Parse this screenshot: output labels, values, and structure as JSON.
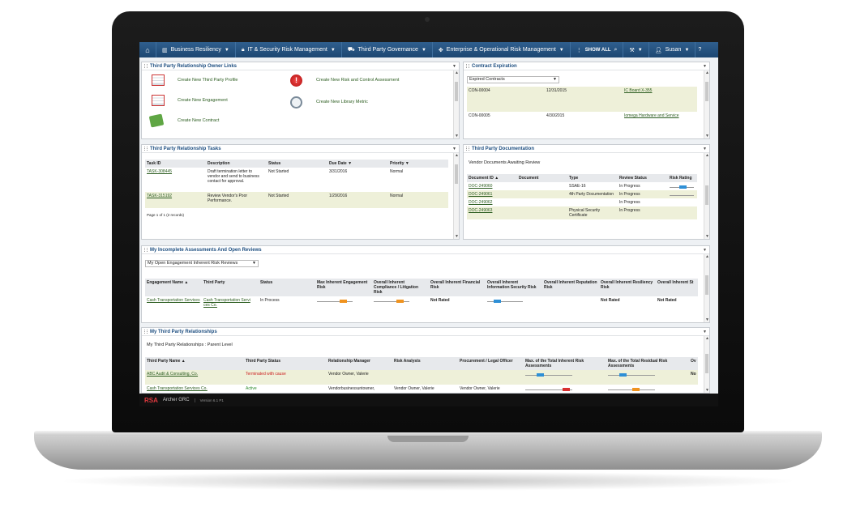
{
  "nav": {
    "items": [
      {
        "label": "Business Resiliency"
      },
      {
        "label": "IT & Security Risk Management"
      },
      {
        "label": "Third Party Governance"
      },
      {
        "label": "Enterprise & Operational Risk Management"
      }
    ],
    "show_all": "SHOW ALL",
    "user": "Susan"
  },
  "owner_links": {
    "title": "Third Party Relationship Owner Links",
    "left": [
      "Create New Third Party Profile",
      "Create New Engagement",
      "Create New Contract"
    ],
    "right": [
      "Create New Risk and Control Assessment",
      "Create New Library Metric"
    ]
  },
  "contract": {
    "title": "Contract Expiration",
    "filter": "Expired Contracts",
    "rows": [
      {
        "id": "CON-00004",
        "date": "12/31/2015",
        "name": "IC Board X-355"
      },
      {
        "id": "CON-00005",
        "date": "4/30/2015",
        "name": "Iomega Hardware and Service"
      }
    ]
  },
  "tasks": {
    "title": "Third Party Relationship Tasks",
    "headers": [
      "Task ID",
      "Description",
      "Status",
      "Due Date",
      "Priority"
    ],
    "rows": [
      {
        "id": "TASK-308445",
        "desc": "Draft termination letter to vendor and send to business contact for approval.",
        "status": "Not Started",
        "due": "3/31/2016",
        "priority": "Normal"
      },
      {
        "id": "TASK-315192",
        "desc": "Review Vendor's Poor Performance.",
        "status": "Not Started",
        "due": "1/29/2016",
        "priority": "Normal"
      }
    ],
    "pager": "Page 1 of 1 (2 records)"
  },
  "docs": {
    "title": "Third Party Documentation",
    "subtitle": "Vendor Documents Awaiting Review",
    "headers": [
      "Document ID",
      "Document",
      "Type",
      "Review Status",
      "Risk Rating"
    ],
    "rows": [
      {
        "id": "DOC-249060",
        "type": "SSAE-16",
        "status": "In Progress"
      },
      {
        "id": "DOC-249061",
        "type": "4th Party Documentation",
        "status": "In Progress"
      },
      {
        "id": "DOC-249062",
        "type": "",
        "status": "In Progress"
      },
      {
        "id": "DOC-249063",
        "type": "Physical Security Certificate",
        "status": "In Progress"
      }
    ]
  },
  "assess": {
    "title": "My Incomplete Assessments And Open Reviews",
    "filter": "My Open Engagement Inherent Risk Reviews",
    "headers": [
      "Engagement Name",
      "Third Party",
      "Status",
      "Max Inherent Engagement Risk",
      "Overall Inherent Compliance / Litigation Risk",
      "Overall Inherent Financial Risk",
      "Overall Inherent Information Security Risk",
      "Overall Inherent Reputation Risk",
      "Overall Inherent Resiliency Risk",
      "Overall Inherent St"
    ],
    "row": {
      "engagement": "Cash Transportation Services",
      "third_party": "Cash Transportation Servi ces Co.",
      "status": "In Process",
      "financial": "Not Rated",
      "resiliency": "Not Rated",
      "st": "Not Rated"
    }
  },
  "relationships": {
    "title": "My Third Party Relationships",
    "subtitle": "My Third Party Relationships : Parent Level",
    "headers": [
      "Third Party Name",
      "Third Party Status",
      "Relationship Manager",
      "Risk Analysts",
      "Procurement / Legal Officer",
      "Max. of the Total Inherent Risk Assessments",
      "Max. of the Total Residual Risk Assessments",
      "Ov"
    ],
    "rows": [
      {
        "name": "ABC Audit & Consulting, Co.",
        "status": "Terminated with cause",
        "manager": "Vendor Owner, Valerie",
        "analysts": "",
        "officer": "",
        "ov": "No"
      },
      {
        "name": "Cash Transportation Services Co.",
        "status": "Active",
        "manager": "Vendorbusinessuntowner,",
        "analysts": "Vendor Owner, Valerie",
        "officer": "Vendor Owner, Valerie",
        "ov": ""
      }
    ]
  },
  "footer": {
    "brand": "RSA",
    "product": "Archer GRC",
    "version": "Version 6.1 P1"
  },
  "colors": {
    "nav": "#1d4772",
    "row_alt": "#eef0d9",
    "link": "#2b5c1f",
    "gauge_blue": "#2e8fd6",
    "gauge_orange": "#f0931e",
    "gauge_red": "#d93030"
  }
}
